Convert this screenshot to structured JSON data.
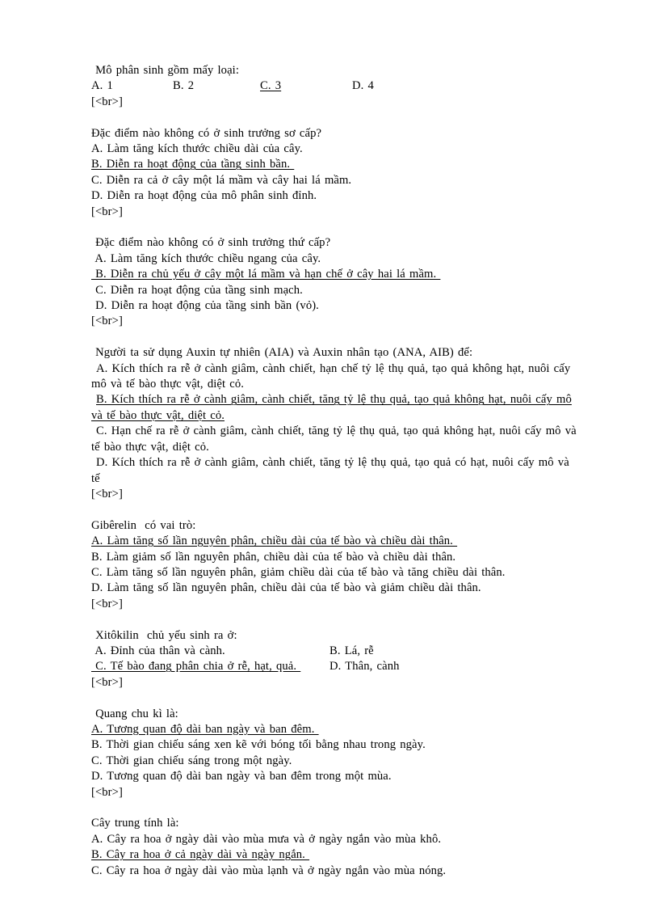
{
  "document": {
    "type": "quiz-worksheet",
    "language": "vi",
    "background_color": "#ffffff",
    "text_color": "#000000"
  },
  "questions": [
    {
      "id": "q1",
      "stem": " Mô phân sinh gồm mấy loại:",
      "layout": "inline-4col",
      "options": [
        {
          "label": "A. 1",
          "underlined": false
        },
        {
          "label": "B. 2",
          "underlined": false
        },
        {
          "label": "C. 3",
          "underlined": true
        },
        {
          "label": "D. 4",
          "underlined": false
        }
      ],
      "separator": "[<br>]"
    },
    {
      "id": "q2",
      "stem": "Đặc điểm nào không có ở sinh trưởng sơ cấp?",
      "layout": "stacked",
      "options": [
        {
          "label": "A. Làm tăng kích thước chiều dài của cây.",
          "underlined": false
        },
        {
          "label": "B. Diễn ra hoạt động của tầng sinh bần. ",
          "underlined": true
        },
        {
          "label": "C. Diễn ra cả ở cây một lá mầm và cây hai lá mầm.",
          "underlined": false
        },
        {
          "label": "D. Diễn ra hoạt động của mô phân sinh đỉnh.",
          "underlined": false
        }
      ],
      "separator": "[<br>]"
    },
    {
      "id": "q3",
      "stem": " Đặc điểm nào không có ở sinh trưởng thứ cấp?",
      "layout": "stacked",
      "options": [
        {
          "label": " A. Làm tăng kích thước chiều ngang của cây.",
          "underlined": false
        },
        {
          "label": " B. Diễn ra chủ yếu ở cây một lá mầm và hạn chế ở cây hai lá mầm. ",
          "underlined": true
        },
        {
          "label": " C. Diễn ra hoạt động của tầng sinh mạch.",
          "underlined": false
        },
        {
          "label": " D. Diễn ra hoạt động của tầng sinh bần (vỏ).",
          "underlined": false
        }
      ],
      "separator": "[<br>]"
    },
    {
      "id": "q4",
      "stem": " Người ta sử dụng Auxin tự nhiên (AIA) và Auxin nhân tạo (ANA, AIB) để:",
      "layout": "stacked-wrapped",
      "options": [
        {
          "label": " A. Kích thích ra rễ ở cành giâm, cành chiết, hạn chế tỷ lệ thụ quả, tạo quả không hạt, nuôi cấy mô và tế bào thực vật, diệt cỏ.",
          "underlined": false
        },
        {
          "label": " B. Kích thích ra rễ ở cành giâm, cành chiết, tăng tỷ lệ thụ quả, tạo quả không hạt, nuôi cấy mô và tế bào thực vật, diệt cỏ. ",
          "underlined": true
        },
        {
          "label": " C. Hạn chế ra rễ ở cành giâm, cành chiết, tăng tỷ lệ thụ quả, tạo quả không hạt, nuôi cấy mô và tế bào thực vật, diệt cỏ.",
          "underlined": false
        },
        {
          "label": " D. Kích thích ra rễ ở cành giâm, cành chiết, tăng tỷ lệ thụ quả, tạo quả có hạt, nuôi cấy mô và tế",
          "underlined": false
        }
      ],
      "separator": "[<br>]"
    },
    {
      "id": "q5",
      "stem": "Gibêrelin  có vai trò:",
      "layout": "stacked",
      "options": [
        {
          "label": "A. Làm tăng số lần nguyên phân, chiều dài của tế bào và chiều dài thân. ",
          "underlined": true
        },
        {
          "label": "B. Làm giảm số lần nguyên phân, chiều dài của tế bào và chiều dài thân.",
          "underlined": false
        },
        {
          "label": "C. Làm tăng số lần nguyên phân, giảm chiều dài của tế bào và tăng chiều dài thân.",
          "underlined": false
        },
        {
          "label": "D. Làm tăng số lần nguyên phân, chiều dài của tế bào và giảm chiều dài thân.",
          "underlined": false
        }
      ],
      "separator": "[<br>]"
    },
    {
      "id": "q6",
      "stem": " Xitôkilin  chủ yếu sinh ra ở:",
      "layout": "two-col",
      "option_rows": [
        {
          "left": {
            "label": " A. Đỉnh của thân và cành.",
            "underlined": false
          },
          "right": {
            "label": "B. Lá, rễ",
            "underlined": false
          }
        },
        {
          "left": {
            "label": " C. Tế bào đang phân chia ở rễ, hạt, quả. ",
            "underlined": true
          },
          "right": {
            "label": "D. Thân, cành",
            "underlined": false
          }
        }
      ],
      "separator": "[<br>]"
    },
    {
      "id": "q7",
      "stem": " Quang chu kì là:",
      "layout": "stacked",
      "options": [
        {
          "label": "A. Tương quan độ dài ban ngày và ban đêm. ",
          "underlined": true
        },
        {
          "label": "B. Thời gian chiếu sáng xen kẽ với bóng tối bằng nhau trong ngày.",
          "underlined": false
        },
        {
          "label": "C. Thời gian chiếu sáng trong một ngày.",
          "underlined": false
        },
        {
          "label": "D. Tương quan độ dài ban ngày và ban đêm trong một mùa.",
          "underlined": false
        }
      ],
      "separator": "[<br>]"
    },
    {
      "id": "q8",
      "stem": "Cây trung tính là:",
      "layout": "stacked",
      "options": [
        {
          "label": "A. Cây ra hoa ở ngày dài vào mùa mưa và ở ngày ngắn vào mùa khô.",
          "underlined": false
        },
        {
          "label": "B. Cây ra hoa ở cả ngày dài và ngày ngắn. ",
          "underlined": true
        },
        {
          "label": "C. Cây ra hoa ở ngày dài vào mùa lạnh và ở ngày ngắn vào mùa nóng.",
          "underlined": false
        }
      ],
      "separator": ""
    }
  ]
}
